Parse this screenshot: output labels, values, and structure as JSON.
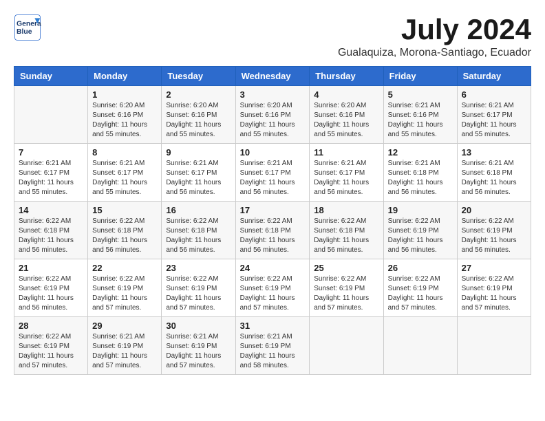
{
  "logo": {
    "line1": "General",
    "line2": "Blue"
  },
  "title": "July 2024",
  "location": "Gualaquiza, Morona-Santiago, Ecuador",
  "days_of_week": [
    "Sunday",
    "Monday",
    "Tuesday",
    "Wednesday",
    "Thursday",
    "Friday",
    "Saturday"
  ],
  "weeks": [
    [
      {
        "day": "",
        "info": ""
      },
      {
        "day": "1",
        "info": "Sunrise: 6:20 AM\nSunset: 6:16 PM\nDaylight: 11 hours\nand 55 minutes."
      },
      {
        "day": "2",
        "info": "Sunrise: 6:20 AM\nSunset: 6:16 PM\nDaylight: 11 hours\nand 55 minutes."
      },
      {
        "day": "3",
        "info": "Sunrise: 6:20 AM\nSunset: 6:16 PM\nDaylight: 11 hours\nand 55 minutes."
      },
      {
        "day": "4",
        "info": "Sunrise: 6:20 AM\nSunset: 6:16 PM\nDaylight: 11 hours\nand 55 minutes."
      },
      {
        "day": "5",
        "info": "Sunrise: 6:21 AM\nSunset: 6:16 PM\nDaylight: 11 hours\nand 55 minutes."
      },
      {
        "day": "6",
        "info": "Sunrise: 6:21 AM\nSunset: 6:17 PM\nDaylight: 11 hours\nand 55 minutes."
      }
    ],
    [
      {
        "day": "7",
        "info": "Sunrise: 6:21 AM\nSunset: 6:17 PM\nDaylight: 11 hours\nand 55 minutes."
      },
      {
        "day": "8",
        "info": "Sunrise: 6:21 AM\nSunset: 6:17 PM\nDaylight: 11 hours\nand 55 minutes."
      },
      {
        "day": "9",
        "info": "Sunrise: 6:21 AM\nSunset: 6:17 PM\nDaylight: 11 hours\nand 56 minutes."
      },
      {
        "day": "10",
        "info": "Sunrise: 6:21 AM\nSunset: 6:17 PM\nDaylight: 11 hours\nand 56 minutes."
      },
      {
        "day": "11",
        "info": "Sunrise: 6:21 AM\nSunset: 6:17 PM\nDaylight: 11 hours\nand 56 minutes."
      },
      {
        "day": "12",
        "info": "Sunrise: 6:21 AM\nSunset: 6:18 PM\nDaylight: 11 hours\nand 56 minutes."
      },
      {
        "day": "13",
        "info": "Sunrise: 6:21 AM\nSunset: 6:18 PM\nDaylight: 11 hours\nand 56 minutes."
      }
    ],
    [
      {
        "day": "14",
        "info": "Sunrise: 6:22 AM\nSunset: 6:18 PM\nDaylight: 11 hours\nand 56 minutes."
      },
      {
        "day": "15",
        "info": "Sunrise: 6:22 AM\nSunset: 6:18 PM\nDaylight: 11 hours\nand 56 minutes."
      },
      {
        "day": "16",
        "info": "Sunrise: 6:22 AM\nSunset: 6:18 PM\nDaylight: 11 hours\nand 56 minutes."
      },
      {
        "day": "17",
        "info": "Sunrise: 6:22 AM\nSunset: 6:18 PM\nDaylight: 11 hours\nand 56 minutes."
      },
      {
        "day": "18",
        "info": "Sunrise: 6:22 AM\nSunset: 6:18 PM\nDaylight: 11 hours\nand 56 minutes."
      },
      {
        "day": "19",
        "info": "Sunrise: 6:22 AM\nSunset: 6:19 PM\nDaylight: 11 hours\nand 56 minutes."
      },
      {
        "day": "20",
        "info": "Sunrise: 6:22 AM\nSunset: 6:19 PM\nDaylight: 11 hours\nand 56 minutes."
      }
    ],
    [
      {
        "day": "21",
        "info": "Sunrise: 6:22 AM\nSunset: 6:19 PM\nDaylight: 11 hours\nand 56 minutes."
      },
      {
        "day": "22",
        "info": "Sunrise: 6:22 AM\nSunset: 6:19 PM\nDaylight: 11 hours\nand 57 minutes."
      },
      {
        "day": "23",
        "info": "Sunrise: 6:22 AM\nSunset: 6:19 PM\nDaylight: 11 hours\nand 57 minutes."
      },
      {
        "day": "24",
        "info": "Sunrise: 6:22 AM\nSunset: 6:19 PM\nDaylight: 11 hours\nand 57 minutes."
      },
      {
        "day": "25",
        "info": "Sunrise: 6:22 AM\nSunset: 6:19 PM\nDaylight: 11 hours\nand 57 minutes."
      },
      {
        "day": "26",
        "info": "Sunrise: 6:22 AM\nSunset: 6:19 PM\nDaylight: 11 hours\nand 57 minutes."
      },
      {
        "day": "27",
        "info": "Sunrise: 6:22 AM\nSunset: 6:19 PM\nDaylight: 11 hours\nand 57 minutes."
      }
    ],
    [
      {
        "day": "28",
        "info": "Sunrise: 6:22 AM\nSunset: 6:19 PM\nDaylight: 11 hours\nand 57 minutes."
      },
      {
        "day": "29",
        "info": "Sunrise: 6:21 AM\nSunset: 6:19 PM\nDaylight: 11 hours\nand 57 minutes."
      },
      {
        "day": "30",
        "info": "Sunrise: 6:21 AM\nSunset: 6:19 PM\nDaylight: 11 hours\nand 57 minutes."
      },
      {
        "day": "31",
        "info": "Sunrise: 6:21 AM\nSunset: 6:19 PM\nDaylight: 11 hours\nand 58 minutes."
      },
      {
        "day": "",
        "info": ""
      },
      {
        "day": "",
        "info": ""
      },
      {
        "day": "",
        "info": ""
      }
    ]
  ]
}
